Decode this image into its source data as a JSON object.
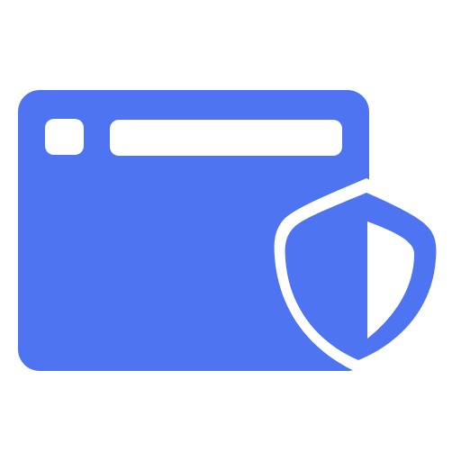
{
  "icon": {
    "name": "secure-browser-window-icon",
    "accent_color": "#4E74F2",
    "background_color": "#FFFFFF"
  }
}
